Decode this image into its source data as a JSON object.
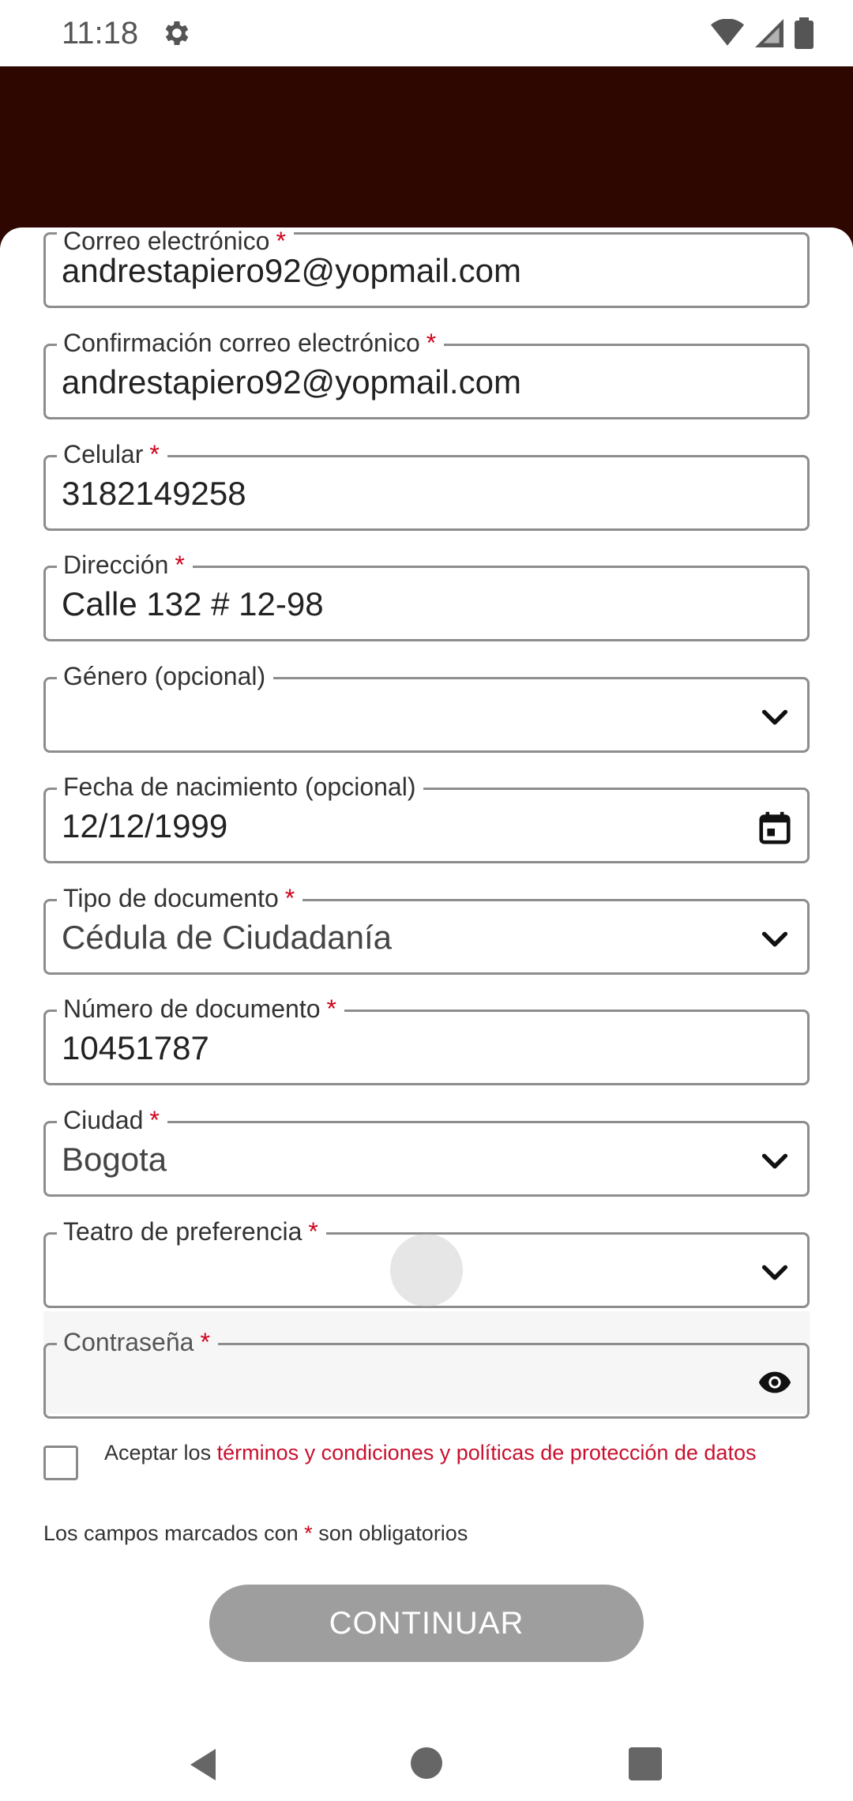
{
  "status_bar": {
    "time": "11:18"
  },
  "fields": [
    {
      "label": "Correo electrónico",
      "required": "*",
      "value": "andrestapiero92@yopmail.com"
    },
    {
      "label": "Confirmación correo electrónico",
      "required": "*",
      "value": "andrestapiero92@yopmail.com"
    },
    {
      "label": "Celular",
      "required": "*",
      "value": "3182149258"
    },
    {
      "label": "Dirección",
      "required": "*",
      "value": "Calle 132 # 12-98"
    },
    {
      "label": "Género (opcional)",
      "value": ""
    },
    {
      "label": "Fecha de nacimiento (opcional)",
      "value": "12/12/1999"
    },
    {
      "label": "Tipo de documento",
      "required": "*",
      "value": "Cédula de Ciudadanía"
    },
    {
      "label": "Número de documento",
      "required": "*",
      "value": "10451787"
    },
    {
      "label": "Ciudad",
      "required": "*",
      "value": "Bogota"
    },
    {
      "label": "Teatro de preferencia",
      "required": "*",
      "value": ""
    },
    {
      "label": "Contraseña",
      "required": "*",
      "value": ""
    }
  ],
  "terms": {
    "prefix": "Aceptar los",
    "link": "términos y condiciones y políticas de protección de datos"
  },
  "required_note": {
    "before": "Los campos marcados con",
    "asterisk": "*",
    "after": "son obligatorios"
  },
  "continue_label": "CONTINUAR",
  "colors": {
    "header": "#2e0800",
    "required": "#d0021b",
    "button_disabled": "#9e9e9e"
  },
  "icons": [
    "gear-icon",
    "wifi-icon",
    "signal-icon",
    "battery-icon",
    "chevron-down-icon",
    "calendar-icon",
    "eye-icon",
    "back-icon",
    "home-icon",
    "recents-icon"
  ]
}
